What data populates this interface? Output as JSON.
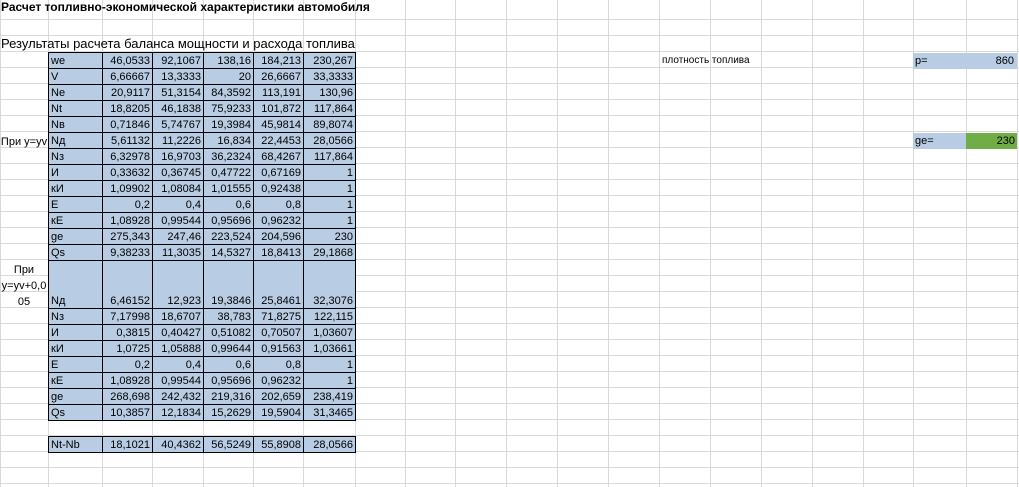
{
  "sheet": {
    "title": "Расчет топливно-экономической характеристики автомобиля",
    "subtitle": "Результаты расчета баланса мощности и расхода топлива",
    "side_label_1": "При у=уv",
    "side_label_2_lines": [
      "При",
      "у=уv+0,0",
      "05"
    ],
    "fuel_density_label": "плотность топлива",
    "rho_label": "p=",
    "rho_value": "860",
    "ge_label": "ge=",
    "ge_value": "230",
    "colors": {
      "table_fill": "#b8cce4",
      "green_fill": "#70ad47",
      "grid": "#d9d9d9"
    }
  },
  "table1": [
    {
      "label": "we",
      "v": [
        "46,0533",
        "92,1067",
        "138,16",
        "184,213",
        "230,267"
      ]
    },
    {
      "label": "V",
      "v": [
        "6,66667",
        "13,3333",
        "20",
        "26,6667",
        "33,3333"
      ]
    },
    {
      "label": "Ne",
      "v": [
        "20,9117",
        "51,3154",
        "84,3592",
        "113,191",
        "130,96"
      ]
    },
    {
      "label": "Nt",
      "v": [
        "18,8205",
        "46,1838",
        "75,9233",
        "101,872",
        "117,864"
      ]
    },
    {
      "label": "Nв",
      "v": [
        "0,71846",
        "5,74767",
        "19,3984",
        "45,9814",
        "89,8074"
      ]
    },
    {
      "label": "Nд",
      "v": [
        "5,61132",
        "11,2226",
        "16,834",
        "22,4453",
        "28,0566"
      ]
    },
    {
      "label": "Nз",
      "v": [
        "6,32978",
        "16,9703",
        "36,2324",
        "68,4267",
        "117,864"
      ]
    },
    {
      "label": "И",
      "v": [
        "0,33632",
        "0,36745",
        "0,47722",
        "0,67169",
        "1"
      ]
    },
    {
      "label": "кИ",
      "v": [
        "1,09902",
        "1,08084",
        "1,01555",
        "0,92438",
        "1"
      ]
    },
    {
      "label": "Е",
      "v": [
        "0,2",
        "0,4",
        "0,6",
        "0,8",
        "1"
      ]
    },
    {
      "label": "кЕ",
      "v": [
        "1,08928",
        "0,99544",
        "0,95696",
        "0,96232",
        "1"
      ]
    },
    {
      "label": "ge",
      "v": [
        "275,343",
        "247,46",
        "223,524",
        "204,596",
        "230"
      ]
    },
    {
      "label": "Qs",
      "v": [
        "9,38233",
        "11,3035",
        "14,5327",
        "18,8413",
        "29,1868"
      ]
    }
  ],
  "table2": [
    {
      "label": "Nд",
      "v": [
        "6,46152",
        "12,923",
        "19,3846",
        "25,8461",
        "32,3076"
      ]
    },
    {
      "label": "Nз",
      "v": [
        "7,17998",
        "18,6707",
        "38,783",
        "71,8275",
        "122,115"
      ]
    },
    {
      "label": "И",
      "v": [
        "0,3815",
        "0,40427",
        "0,51082",
        "0,70507",
        "1,03607"
      ]
    },
    {
      "label": "кИ",
      "v": [
        "1,0725",
        "1,05888",
        "0,99644",
        "0,91563",
        "1,03661"
      ]
    },
    {
      "label": "Е",
      "v": [
        "0,2",
        "0,4",
        "0,6",
        "0,8",
        "1"
      ]
    },
    {
      "label": "кЕ",
      "v": [
        "1,08928",
        "0,99544",
        "0,95696",
        "0,96232",
        "1"
      ]
    },
    {
      "label": "ge",
      "v": [
        "268,698",
        "242,432",
        "219,316",
        "202,659",
        "238,419"
      ]
    },
    {
      "label": "Qs",
      "v": [
        "10,3857",
        "12,1834",
        "15,2629",
        "19,5904",
        "31,3465"
      ]
    }
  ],
  "summary": {
    "label": "Nt-Nb",
    "v": [
      "18,1021",
      "40,4362",
      "56,5249",
      "55,8908",
      "28,0566"
    ]
  }
}
